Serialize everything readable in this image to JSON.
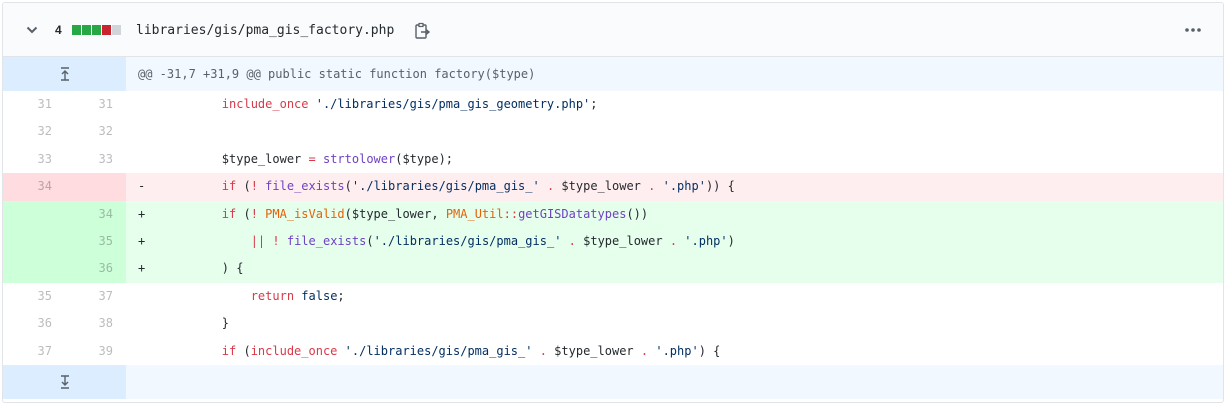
{
  "header": {
    "changes_count": "4",
    "diffstat": [
      "#28a745",
      "#28a745",
      "#28a745",
      "#cb2431",
      "#d1d5da"
    ],
    "filename": "libraries/gis/pma_gis_factory.php"
  },
  "hunk": {
    "header_text": "@@ -31,7 +31,9 @@ public static function factory($type)"
  },
  "lines": [
    {
      "type": "ctx",
      "old": "31",
      "new": "31",
      "sign": "",
      "tokens": [
        {
          "t": "        "
        },
        {
          "c": "k",
          "t": "include_once"
        },
        {
          "t": " "
        },
        {
          "c": "s",
          "t": "'./libraries/gis/pma_gis_geometry.php'"
        },
        {
          "t": ";"
        }
      ]
    },
    {
      "type": "ctx",
      "old": "32",
      "new": "32",
      "sign": "",
      "tokens": [
        {
          "t": ""
        }
      ]
    },
    {
      "type": "ctx",
      "old": "33",
      "new": "33",
      "sign": "",
      "tokens": [
        {
          "t": "        $type_lower "
        },
        {
          "c": "k",
          "t": "="
        },
        {
          "t": " "
        },
        {
          "c": "f",
          "t": "strtolower"
        },
        {
          "t": "($type);"
        }
      ]
    },
    {
      "type": "del",
      "old": "34",
      "new": "",
      "sign": "-",
      "tokens": [
        {
          "t": "        "
        },
        {
          "c": "k",
          "t": "if"
        },
        {
          "t": " ("
        },
        {
          "c": "k",
          "t": "!"
        },
        {
          "t": " "
        },
        {
          "c": "f",
          "t": "file_exists"
        },
        {
          "t": "("
        },
        {
          "c": "s",
          "t": "'./libraries/gis/pma_gis_'"
        },
        {
          "t": " "
        },
        {
          "c": "k",
          "t": "."
        },
        {
          "t": " $type_lower "
        },
        {
          "c": "k",
          "t": "."
        },
        {
          "t": " "
        },
        {
          "c": "s",
          "t": "'.php'"
        },
        {
          "t": ")) {"
        }
      ]
    },
    {
      "type": "add",
      "old": "",
      "new": "34",
      "sign": "+",
      "tokens": [
        {
          "t": "        "
        },
        {
          "c": "k",
          "t": "if"
        },
        {
          "t": " ("
        },
        {
          "c": "k",
          "t": "!"
        },
        {
          "t": " "
        },
        {
          "c": "e",
          "t": "PMA_isValid"
        },
        {
          "t": "($type_lower, "
        },
        {
          "c": "e",
          "t": "PMA_Util"
        },
        {
          "c": "k",
          "t": "::"
        },
        {
          "c": "f",
          "t": "getGISDatatypes"
        },
        {
          "t": "())"
        }
      ]
    },
    {
      "type": "add",
      "old": "",
      "new": "35",
      "sign": "+",
      "tokens": [
        {
          "t": "            "
        },
        {
          "c": "k",
          "t": "||"
        },
        {
          "t": " "
        },
        {
          "c": "k",
          "t": "!"
        },
        {
          "t": " "
        },
        {
          "c": "f",
          "t": "file_exists"
        },
        {
          "t": "("
        },
        {
          "c": "s",
          "t": "'./libraries/gis/pma_gis_'"
        },
        {
          "t": " "
        },
        {
          "c": "k",
          "t": "."
        },
        {
          "t": " $type_lower "
        },
        {
          "c": "k",
          "t": "."
        },
        {
          "t": " "
        },
        {
          "c": "s",
          "t": "'.php'"
        },
        {
          "t": ")"
        }
      ]
    },
    {
      "type": "add",
      "old": "",
      "new": "36",
      "sign": "+",
      "tokens": [
        {
          "t": "        ) {"
        }
      ]
    },
    {
      "type": "ctx",
      "old": "35",
      "new": "37",
      "sign": "",
      "tokens": [
        {
          "t": "            "
        },
        {
          "c": "k",
          "t": "return"
        },
        {
          "t": " "
        },
        {
          "c": "s",
          "t": "false"
        },
        {
          "t": ";"
        }
      ]
    },
    {
      "type": "ctx",
      "old": "36",
      "new": "38",
      "sign": "",
      "tokens": [
        {
          "t": "        }"
        }
      ]
    },
    {
      "type": "ctx",
      "old": "37",
      "new": "39",
      "sign": "",
      "tokens": [
        {
          "t": "        "
        },
        {
          "c": "k",
          "t": "if"
        },
        {
          "t": " ("
        },
        {
          "c": "k",
          "t": "include_once"
        },
        {
          "t": " "
        },
        {
          "c": "s",
          "t": "'./libraries/gis/pma_gis_'"
        },
        {
          "t": " "
        },
        {
          "c": "k",
          "t": "."
        },
        {
          "t": " $type_lower "
        },
        {
          "c": "k",
          "t": "."
        },
        {
          "t": " "
        },
        {
          "c": "s",
          "t": "'.php'"
        },
        {
          "t": ") {"
        }
      ]
    }
  ],
  "icons": {
    "collapse": "chevron-down-icon",
    "copy": "clippy-icon",
    "more": "kebab-horizontal-icon",
    "expand_up": "unfold-up-icon",
    "expand_down": "unfold-down-icon"
  }
}
